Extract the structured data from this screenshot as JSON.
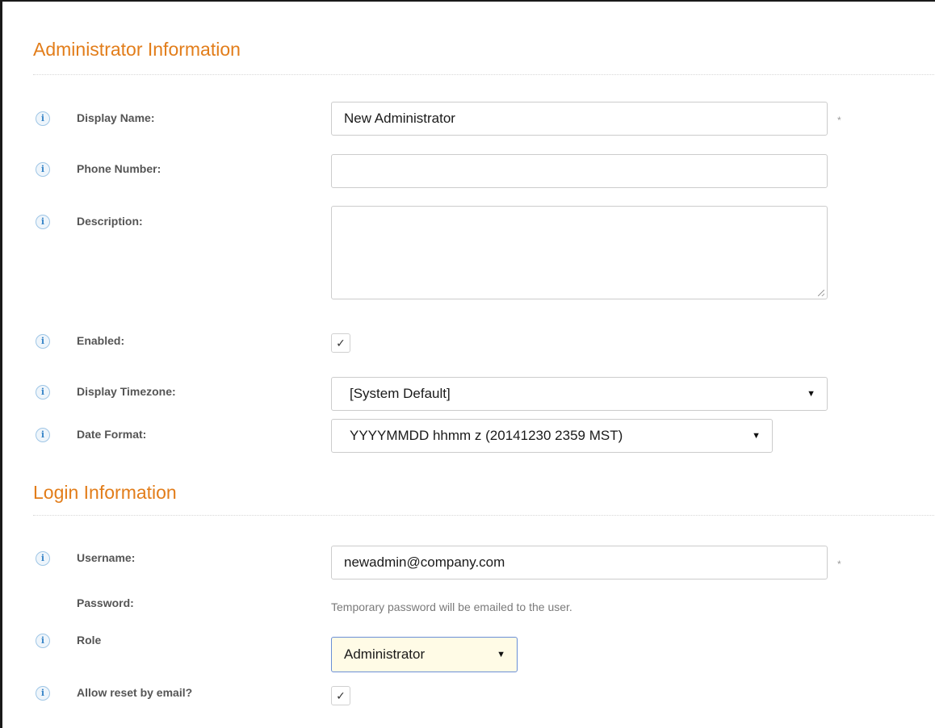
{
  "admin_section": {
    "title": "Administrator Information",
    "display_name": {
      "label": "Display Name:",
      "value": "New Administrator",
      "required": "*"
    },
    "phone_number": {
      "label": "Phone Number:",
      "value": ""
    },
    "description": {
      "label": "Description:",
      "value": ""
    },
    "enabled": {
      "label": "Enabled:",
      "checked": true,
      "mark": "✓"
    },
    "display_timezone": {
      "label": "Display Timezone:",
      "value": "[System Default]"
    },
    "date_format": {
      "label": "Date Format:",
      "value": "YYYYMMDD hhmm z (20141230 2359 MST)"
    }
  },
  "login_section": {
    "title": "Login Information",
    "username": {
      "label": "Username:",
      "value": "newadmin@company.com",
      "required": "*"
    },
    "password": {
      "label": "Password:",
      "hint": "Temporary password will be emailed to the user."
    },
    "role": {
      "label": "Role",
      "value": "Administrator"
    },
    "allow_reset": {
      "label": "Allow reset by email?",
      "checked": true,
      "mark": "✓"
    }
  },
  "icons": {
    "info": "i",
    "dropdown_arrow": "▼"
  },
  "colors": {
    "section_title": "#e27d1a",
    "info_icon": "#3a86c8",
    "role_highlight_bg": "#fffbe6",
    "role_highlight_border": "#6b8fd6"
  }
}
